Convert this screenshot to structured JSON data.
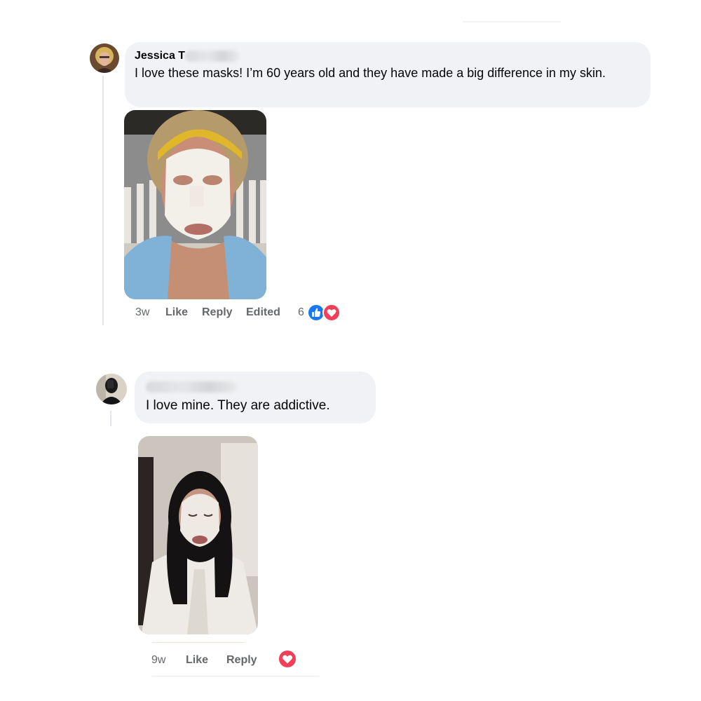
{
  "comments": [
    {
      "author": "Jessica T",
      "text": "I love these masks! I’m 60 years old and they have made a big difference in my skin.",
      "time": "3w",
      "like": "Like",
      "reply": "Reply",
      "edited": "Edited",
      "reaction_count": "6",
      "reactions": [
        "like-icon",
        "love-icon"
      ]
    },
    {
      "author": "",
      "text": "I love mine. They are addictive.",
      "time": "9w",
      "like": "Like",
      "reply": "Reply",
      "reactions": [
        "love-icon"
      ]
    }
  ],
  "colors": {
    "bubble": "#f0f2f5",
    "meta_text": "#65676b",
    "like_blue": "#1877f2",
    "love_red": "#f33e58"
  }
}
